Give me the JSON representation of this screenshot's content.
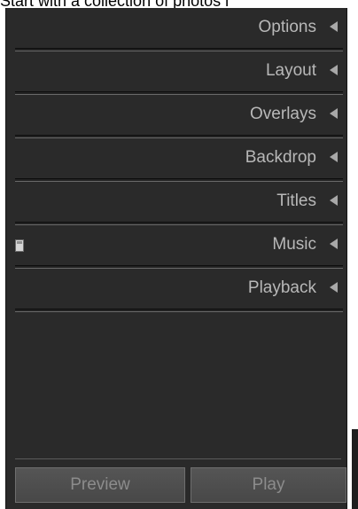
{
  "header": {
    "caption": "Start with a collection of photos i"
  },
  "sections": [
    {
      "label": "Options",
      "arrow_icon": "collapse-triangle-left-icon"
    },
    {
      "label": "Layout",
      "arrow_icon": "collapse-triangle-left-icon"
    },
    {
      "label": "Overlays",
      "arrow_icon": "collapse-triangle-left-icon"
    },
    {
      "label": "Backdrop",
      "arrow_icon": "collapse-triangle-left-icon"
    },
    {
      "label": "Titles",
      "arrow_icon": "collapse-triangle-left-icon"
    },
    {
      "label": "Music",
      "arrow_icon": "collapse-triangle-left-icon"
    },
    {
      "label": "Playback",
      "arrow_icon": "collapse-triangle-left-icon"
    }
  ],
  "footer": {
    "preview_label": "Preview",
    "play_label": "Play"
  },
  "colors": {
    "panel_bg": "#2a2a2a",
    "label_text": "#b8b8b8",
    "button_text": "#8c8c8c"
  }
}
